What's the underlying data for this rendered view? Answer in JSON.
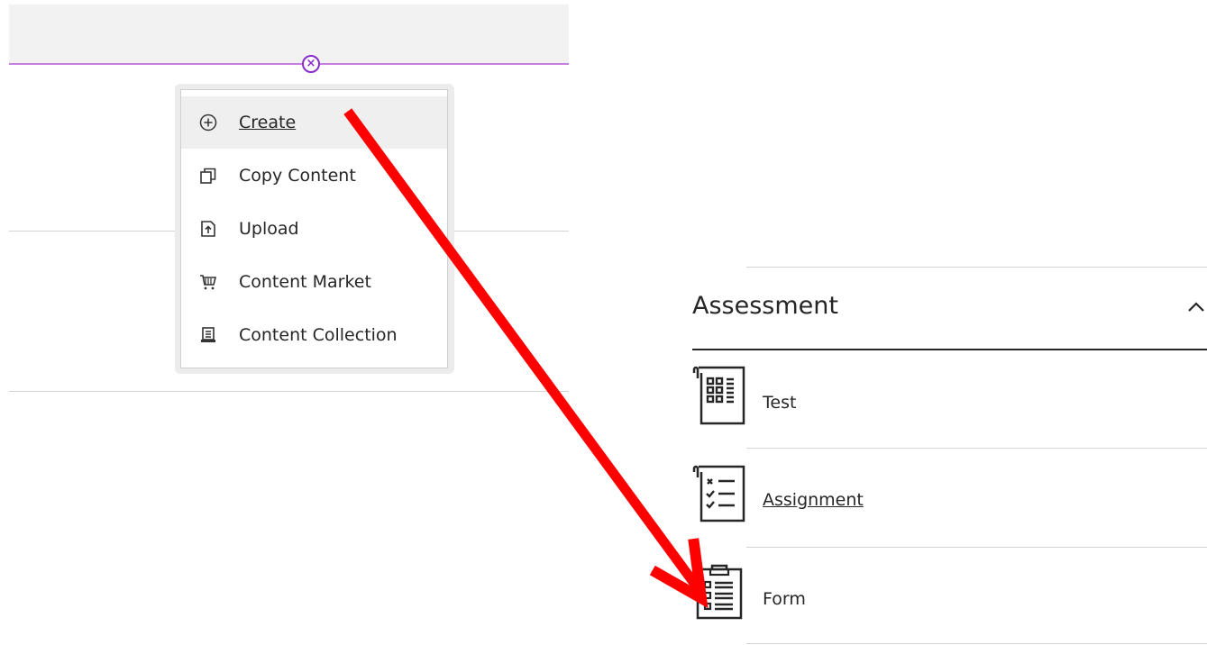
{
  "create_menu": {
    "items": [
      {
        "label": "Create",
        "icon": "plus-circle-icon",
        "active": true
      },
      {
        "label": "Copy Content",
        "icon": "copy-icon"
      },
      {
        "label": "Upload",
        "icon": "upload-icon"
      },
      {
        "label": "Content Market",
        "icon": "cart-icon"
      },
      {
        "label": "Content Collection",
        "icon": "collection-icon"
      }
    ],
    "close_icon": "close-circle-icon"
  },
  "assessment": {
    "title": "Assessment",
    "toggle_icon": "chevron-up-icon",
    "items": [
      {
        "label": "Test",
        "icon": "test-icon"
      },
      {
        "label": "Assignment",
        "icon": "assignment-icon"
      },
      {
        "label": "Form",
        "icon": "form-icon"
      }
    ]
  },
  "colors": {
    "accent_purple": "#8a2cc9",
    "arrow_red": "#ff0000",
    "text": "#262626"
  }
}
